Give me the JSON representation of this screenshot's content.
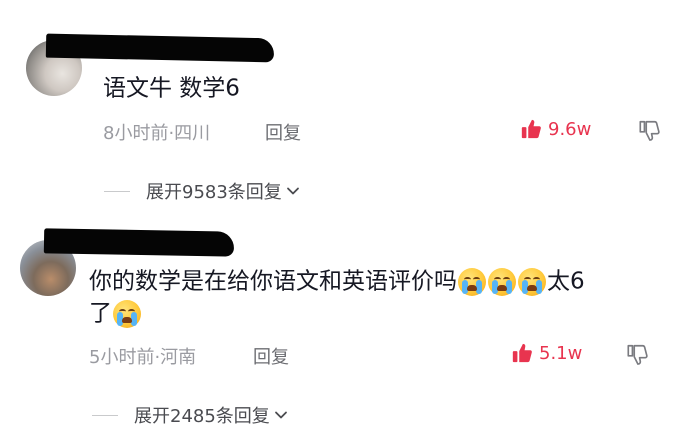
{
  "comments": [
    {
      "text": "语文牛  数学6",
      "time_location": "8小时前·四川",
      "reply_label": "回复",
      "likes": "9.6w",
      "expand_label": "展开9583条回复"
    },
    {
      "text_line1": "你的数学是在给你语文和英语评价吗",
      "text_line1_tail": "太6",
      "text_line2": "了",
      "time_location": "5小时前·河南",
      "reply_label": "回复",
      "likes": "5.1w",
      "expand_label": "展开2485条回复"
    }
  ],
  "icons": {
    "like": "thumbs-up-icon",
    "dislike": "thumbs-down-icon",
    "expand": "chevron-down-icon",
    "emoji": "crying-face-emoji"
  },
  "colors": {
    "like": "#e8344f",
    "text": "#161823",
    "meta": "#9a9ba1"
  }
}
